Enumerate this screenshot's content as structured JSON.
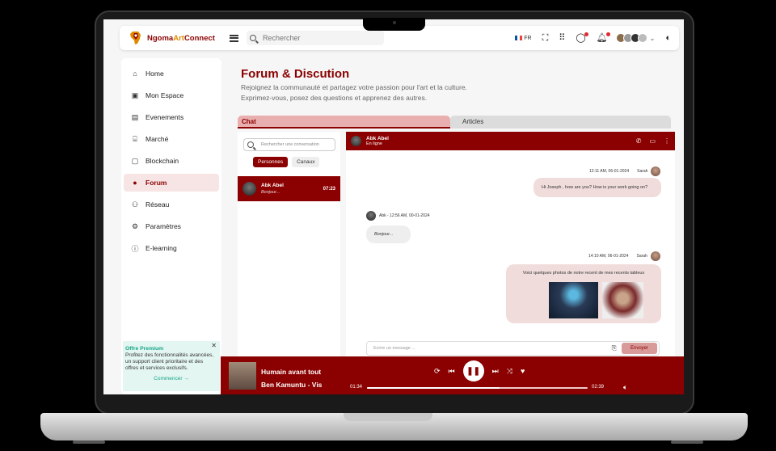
{
  "app": {
    "brand_part1": "Ngoma",
    "brand_part2": "Art",
    "brand_part3": "Connect"
  },
  "topbar": {
    "search_placeholder": "Rechercher",
    "lang": "FR",
    "icons": [
      "fullscreen-icon",
      "apps-icon",
      "chat-icon",
      "bell-icon",
      "moon-icon"
    ]
  },
  "sidebar": {
    "items": [
      {
        "label": "Home",
        "icon": "home-icon",
        "glyph": "⌂"
      },
      {
        "label": "Mon Espace",
        "icon": "space-icon",
        "glyph": "▣"
      },
      {
        "label": "Evenements",
        "icon": "calendar-icon",
        "glyph": "▤"
      },
      {
        "label": "Marché",
        "icon": "store-icon",
        "glyph": "⌸"
      },
      {
        "label": "Blockchain",
        "icon": "blockchain-icon",
        "glyph": "▢"
      },
      {
        "label": "Forum",
        "icon": "forum-icon",
        "glyph": "●"
      },
      {
        "label": "Réseau",
        "icon": "network-icon",
        "glyph": "⚇"
      },
      {
        "label": "Paramètres",
        "icon": "gear-icon",
        "glyph": "⚙"
      },
      {
        "label": "E-learning",
        "icon": "learning-icon",
        "glyph": "ⓘ"
      }
    ],
    "active_index": 5
  },
  "premium": {
    "title": "Offre Premium",
    "text": "Profitez des fonctionnalités avancées, un support client prioritaire et des offres et services exclusifs.",
    "link": "Commencer →"
  },
  "page": {
    "title": "Forum & Discution",
    "subtitle_1": "Rejoignez la communauté et partagez votre passion pour l'art et la culture.",
    "subtitle_2": "Exprimez-vous, posez des questions et apprenez des autres."
  },
  "tabs": {
    "chat": "Chat",
    "articles": "Articles"
  },
  "conversations": {
    "search_placeholder": "Rechercher une conversation",
    "filter_people": "Personnes",
    "filter_channels": "Canaux",
    "items": [
      {
        "name": "Abk Abel",
        "preview": "Bonjour...",
        "time": "07:23"
      }
    ]
  },
  "chat": {
    "contact": "Abk Abel",
    "status": "En ligne",
    "messages": [
      {
        "meta": "12:11 AM, 06-01-2024",
        "author": "Sarah",
        "text": "Hi Joseph , how are you? How is your work going on?"
      },
      {
        "meta": "Abk - 12:56 AM, 00-01-2024",
        "text": "Bonjour..."
      },
      {
        "meta": "14:10 AM, 06-01-2024",
        "author": "Sarah",
        "text": "Voici quelques photos de notre recent de mes recents tableux"
      }
    ],
    "input_placeholder": "Ecrire un message ...",
    "send": "Envoyer"
  },
  "player": {
    "title": "Humain avant tout",
    "artist": "Ben Kamuntu - Vis",
    "current": "01:34",
    "duration": "02:39",
    "progress": 0.6
  },
  "colors": {
    "brand": "#8b0000",
    "accent": "#e08a00",
    "premium": "#17a589"
  }
}
